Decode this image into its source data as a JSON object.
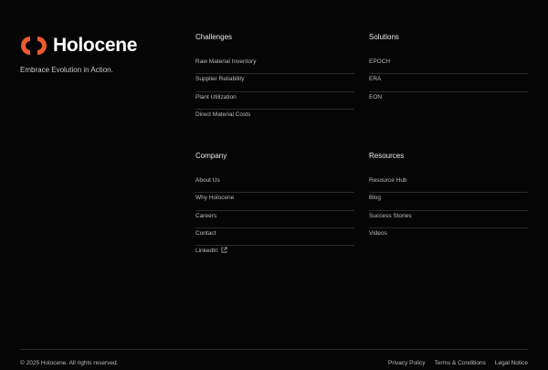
{
  "brand": {
    "name": "Holocene",
    "tagline": "Embrace Evolution in Action.",
    "accent": "#ee5a2f"
  },
  "columns": {
    "challenges": {
      "heading": "Challenges",
      "items": [
        "Raw Material Inventory",
        "Supplier Reliability",
        "Plant Utilization",
        "Direct Material Costs"
      ]
    },
    "solutions": {
      "heading": "Solutions",
      "items": [
        "EPOCH",
        "ERA",
        "EON"
      ]
    },
    "company": {
      "heading": "Company",
      "items": [
        "About Us",
        "Why Holocene",
        "Careers",
        "Contact",
        "LinkedIn"
      ],
      "linkedin_icon": "external-link-icon"
    },
    "resources": {
      "heading": "Resources",
      "items": [
        "Resource Hub",
        "Blog",
        "Success Stories",
        "Videos"
      ]
    }
  },
  "footer": {
    "copyright": "© 2025 Holocene. All rights reserved.",
    "links": [
      "Privacy Policy",
      "Terms & Conditions",
      "Legal Notice"
    ]
  }
}
